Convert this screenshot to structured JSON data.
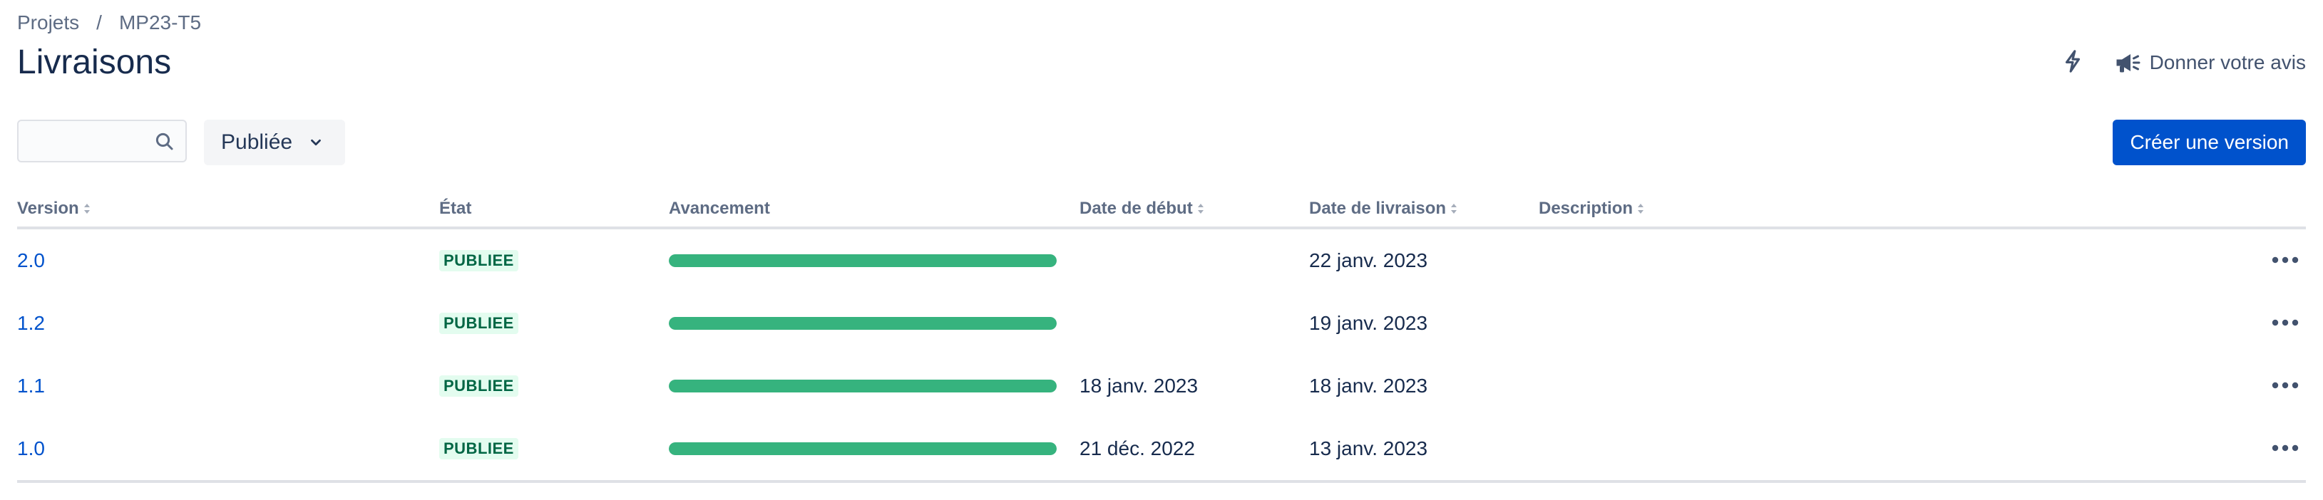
{
  "breadcrumb": {
    "items": [
      "Projets",
      "MP23-T5"
    ],
    "separator": "/"
  },
  "page_title": "Livraisons",
  "actions": {
    "feedback_label": "Donner votre avis",
    "lightning_icon": "lightning-icon",
    "megaphone_icon": "megaphone-icon"
  },
  "toolbar": {
    "search_value": "",
    "search_placeholder": "",
    "status_filter": "Publiée",
    "create_label": "Créer une version"
  },
  "table": {
    "columns": {
      "version": "Version",
      "state": "État",
      "progress": "Avancement",
      "start_date": "Date de début",
      "release_date": "Date de livraison",
      "description": "Description"
    },
    "rows": [
      {
        "version": "2.0",
        "state": "PUBLIEE",
        "progress": 1.0,
        "start_date": "",
        "release_date": "22 janv. 2023",
        "description": ""
      },
      {
        "version": "1.2",
        "state": "PUBLIEE",
        "progress": 1.0,
        "start_date": "",
        "release_date": "19 janv. 2023",
        "description": ""
      },
      {
        "version": "1.1",
        "state": "PUBLIEE",
        "progress": 1.0,
        "start_date": "18 janv. 2023",
        "release_date": "18 janv. 2023",
        "description": ""
      },
      {
        "version": "1.0",
        "state": "PUBLIEE",
        "progress": 1.0,
        "start_date": "21 déc. 2022",
        "release_date": "13 janv. 2023",
        "description": ""
      }
    ]
  },
  "colors": {
    "brand": "#0052cc",
    "progress": "#36b37e",
    "lozenge_bg": "#e3fcef",
    "lozenge_text": "#006644"
  }
}
